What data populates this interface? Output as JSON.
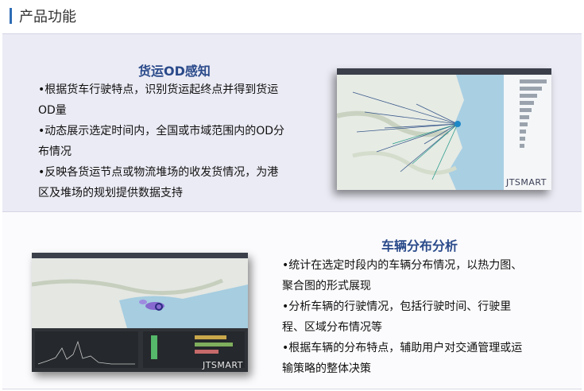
{
  "header": {
    "title": "产品功能"
  },
  "section1": {
    "title": "货运OD感知",
    "bullets": [
      "•根据货车行驶特点，识别货运起终点并得到货运",
      "OD量",
      "•动态展示选定时间内，全国或市域范围内的OD分",
      "布情况",
      "•反映各货运节点或物流堆场的收发货情况，为港",
      "区及堆场的规划提供数据支持"
    ],
    "screenshot_brand": "JTSMART"
  },
  "section2": {
    "title": "车辆分布分析",
    "bullets": [
      "•统计在选定时段内的车辆分布情况，以热力图、",
      "聚合图的形式展现",
      "•分析车辆的行驶情况，包括行驶时间、行驶里",
      "程、区域分布情况等",
      "•根据车辆的分布特点，辅助用户对交通管理或运",
      "输策略的整体决策"
    ],
    "screenshot_brand": "JTSMART"
  },
  "colors": {
    "accent": "#2e6db5",
    "section_title": "#2a4a8a",
    "panel_bg": "#ebebf5"
  }
}
